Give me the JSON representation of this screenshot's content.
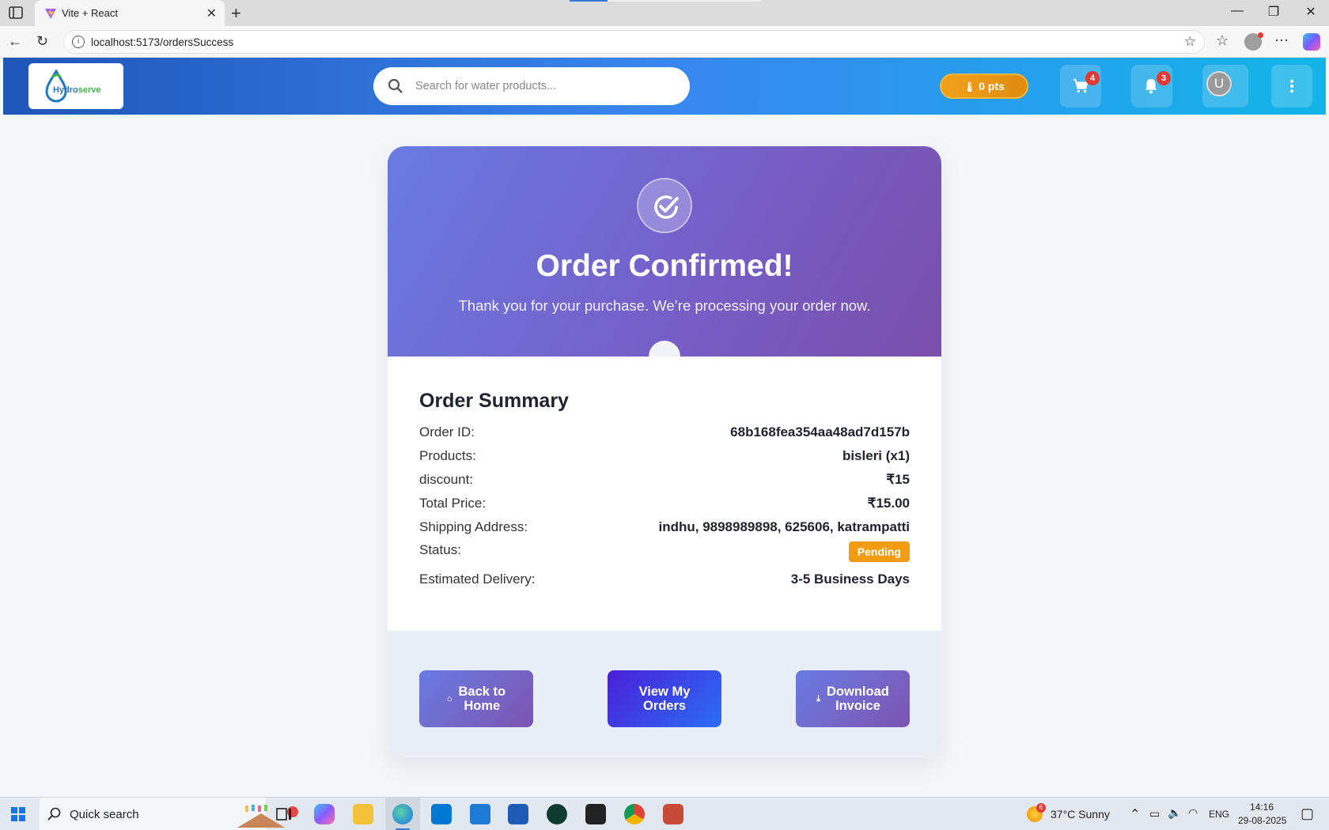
{
  "browser": {
    "tab_title": "Vite + React",
    "url": "localhost:5173/ordersSuccess"
  },
  "header": {
    "logo_text_main": "Hydro",
    "logo_text_accent": "serve",
    "search_placeholder": "Search for water products...",
    "points_label": "0 pts",
    "cart_badge": "4",
    "notifications_badge": "3",
    "avatar_initial": "U"
  },
  "hero": {
    "title": "Order Confirmed!",
    "subtitle": "Thank you for your purchase. We’re processing your order now."
  },
  "summary": {
    "title": "Order Summary",
    "rows": [
      {
        "label": "Order ID:",
        "value": "68b168fea354aa48ad7d157b"
      },
      {
        "label": "Products:",
        "value": "bisleri (x1)"
      },
      {
        "label": "discount:",
        "value": "₹15"
      },
      {
        "label": "Total Price:",
        "value": "₹15.00"
      },
      {
        "label": "Shipping Address:",
        "value": "indhu, 9898989898, 625606, katrampatti"
      },
      {
        "label": "Status:",
        "value": "Pending"
      },
      {
        "label": "Estimated Delivery:",
        "value": "3-5 Business Days"
      }
    ]
  },
  "actions": {
    "home_label": "Back to\nHome",
    "orders_label": "View My\nOrders",
    "invoice_label": "Download\nInvoice"
  },
  "taskbar": {
    "search_label": "Quick search",
    "weather": "37°C  Sunny",
    "weather_badge": "6",
    "lang": "ENG",
    "time": "14:16",
    "date": "29-08-2025"
  },
  "colors": {
    "header_gradient_start": "#1f56b8",
    "header_gradient_end": "#13b5e8",
    "hero_gradient_start": "#6a7be2",
    "hero_gradient_end": "#7a4faa",
    "status_pending": "#f39c12",
    "badge_red": "#e53935"
  }
}
